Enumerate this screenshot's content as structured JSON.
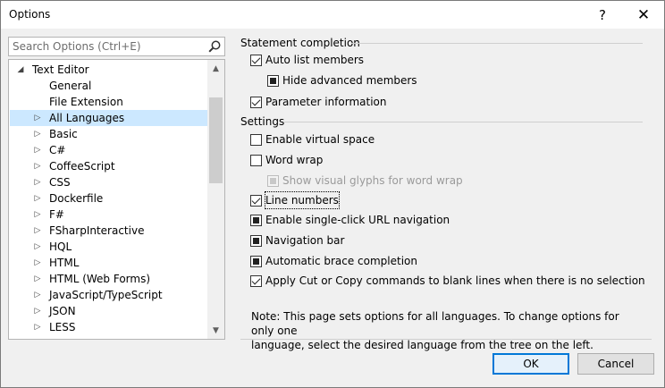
{
  "window": {
    "title": "Options",
    "help_glyph": "?",
    "close_glyph": "✕"
  },
  "search": {
    "placeholder": "Search Options (Ctrl+E)"
  },
  "tree": {
    "items": [
      {
        "label": "Text Editor",
        "level": 0,
        "expander": "◢",
        "selected": false
      },
      {
        "label": "General",
        "level": 1,
        "expander": "",
        "selected": false
      },
      {
        "label": "File Extension",
        "level": 1,
        "expander": "",
        "selected": false
      },
      {
        "label": "All Languages",
        "level": 1,
        "expander": "▷",
        "selected": true
      },
      {
        "label": "Basic",
        "level": 1,
        "expander": "▷",
        "selected": false
      },
      {
        "label": "C#",
        "level": 1,
        "expander": "▷",
        "selected": false
      },
      {
        "label": "CoffeeScript",
        "level": 1,
        "expander": "▷",
        "selected": false
      },
      {
        "label": "CSS",
        "level": 1,
        "expander": "▷",
        "selected": false
      },
      {
        "label": "Dockerfile",
        "level": 1,
        "expander": "▷",
        "selected": false
      },
      {
        "label": "F#",
        "level": 1,
        "expander": "▷",
        "selected": false
      },
      {
        "label": "FSharpInteractive",
        "level": 1,
        "expander": "▷",
        "selected": false
      },
      {
        "label": "HQL",
        "level": 1,
        "expander": "▷",
        "selected": false
      },
      {
        "label": "HTML",
        "level": 1,
        "expander": "▷",
        "selected": false
      },
      {
        "label": "HTML (Web Forms)",
        "level": 1,
        "expander": "▷",
        "selected": false
      },
      {
        "label": "JavaScript/TypeScript",
        "level": 1,
        "expander": "▷",
        "selected": false
      },
      {
        "label": "JSON",
        "level": 1,
        "expander": "▷",
        "selected": false
      },
      {
        "label": "LESS",
        "level": 1,
        "expander": "▷",
        "selected": false
      }
    ],
    "scroll_up_glyph": "▲",
    "scroll_down_glyph": "▼"
  },
  "statement_completion": {
    "header": "Statement completion",
    "options": [
      {
        "label": "Auto list members",
        "state": "checked",
        "indent": 0,
        "disabled": false,
        "focused": false
      },
      {
        "label": "Hide advanced members",
        "state": "indeterminate",
        "indent": 1,
        "disabled": false,
        "focused": false
      },
      {
        "label": "Parameter information",
        "state": "checked",
        "indent": 0,
        "disabled": false,
        "focused": false
      }
    ]
  },
  "settings": {
    "header": "Settings",
    "options": [
      {
        "label": "Enable virtual space",
        "state": "unchecked",
        "indent": 0,
        "disabled": false,
        "focused": false
      },
      {
        "label": "Word wrap",
        "state": "unchecked",
        "indent": 0,
        "disabled": false,
        "focused": false
      },
      {
        "label": "Show visual glyphs for word wrap",
        "state": "indeterminate",
        "indent": 1,
        "disabled": true,
        "focused": false
      },
      {
        "label": "Line numbers",
        "state": "checked",
        "indent": 0,
        "disabled": false,
        "focused": true
      },
      {
        "label": "Enable single-click URL navigation",
        "state": "indeterminate",
        "indent": 0,
        "disabled": false,
        "focused": false
      },
      {
        "label": "Navigation bar",
        "state": "indeterminate",
        "indent": 0,
        "disabled": false,
        "focused": false
      },
      {
        "label": "Automatic brace completion",
        "state": "indeterminate",
        "indent": 0,
        "disabled": false,
        "focused": false
      },
      {
        "label": "Apply Cut or Copy commands to blank lines when there is no selection",
        "state": "checked",
        "indent": 0,
        "disabled": false,
        "focused": false
      }
    ]
  },
  "note": "Note: This page sets options for all languages. To change options for only one\nlanguage, select the desired language from the tree on the left.",
  "buttons": {
    "ok": "OK",
    "cancel": "Cancel"
  }
}
